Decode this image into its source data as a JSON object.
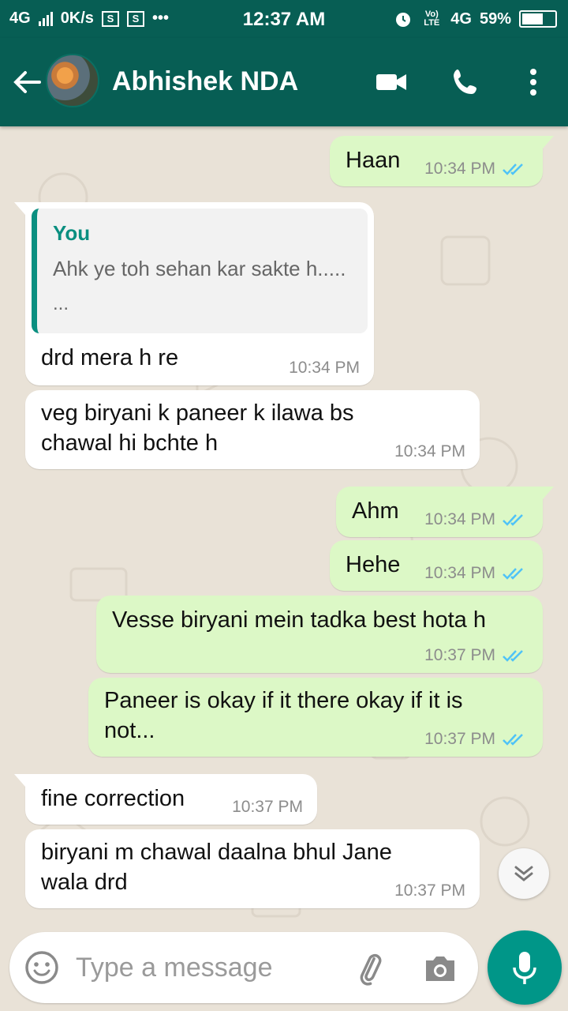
{
  "status_bar": {
    "network": "4G",
    "speed": "0K/s",
    "notif_icon_1": "S",
    "notif_icon_2": "S",
    "more": "•••",
    "time": "12:37 AM",
    "volte": "Vo) LTE",
    "network_2": "4G",
    "battery": "59%"
  },
  "header": {
    "contact_name": "Abhishek NDA",
    "icons": [
      "back-arrow-icon",
      "video-call-icon",
      "phone-icon",
      "more-vert-icon"
    ]
  },
  "messages": [
    {
      "direction": "out",
      "text": "Haan",
      "time": "10:34 PM",
      "ticks": "double-blue"
    },
    {
      "direction": "in",
      "quote_author": "You",
      "quote_text": "Ahk ye toh sehan kar sakte h.....",
      "quote_more": "...",
      "text": "drd mera h re",
      "time": "10:34 PM"
    },
    {
      "direction": "in",
      "text": "veg biryani k paneer k ilawa bs chawal hi bchte h",
      "time": "10:34 PM"
    },
    {
      "direction": "out",
      "text": "Ahm",
      "time": "10:34 PM",
      "ticks": "double-blue"
    },
    {
      "direction": "out",
      "text": "Hehe",
      "time": "10:34 PM",
      "ticks": "double-blue"
    },
    {
      "direction": "out",
      "text": "Vesse biryani mein tadka best hota h",
      "time": "10:37 PM",
      "ticks": "double-blue"
    },
    {
      "direction": "out",
      "text": "Paneer is okay if it there okay if it is not...",
      "time": "10:37 PM",
      "ticks": "double-blue"
    },
    {
      "direction": "in",
      "text": "fine correction",
      "time": "10:37 PM"
    },
    {
      "direction": "in",
      "text": "biryani m chawal daalna bhul Jane wala drd",
      "time": "10:37 PM"
    }
  ],
  "composer": {
    "placeholder": "Type a message",
    "icons": [
      "emoji-icon",
      "attach-icon",
      "camera-icon",
      "mic-icon"
    ]
  },
  "colors": {
    "header": "#075e54",
    "outgoing_bubble": "#dcf8c6",
    "incoming_bubble": "#ffffff",
    "accent": "#009688",
    "read_ticks": "#4fc3f7"
  }
}
